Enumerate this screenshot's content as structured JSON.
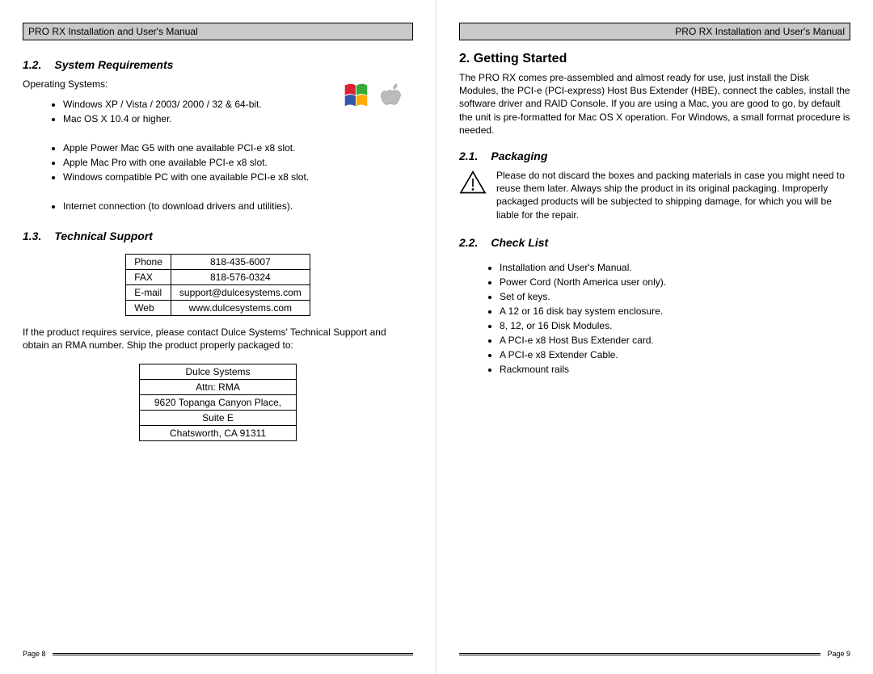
{
  "header": {
    "title": "PRO RX Installation and User's Manual"
  },
  "left": {
    "s12": {
      "num": "1.2.",
      "title": "System Requirements"
    },
    "os_label": "Operating Systems:",
    "os_list1": [
      "Windows XP / Vista / 2003/ 2000 /  32 & 64-bit.",
      "Mac OS X 10.4 or higher."
    ],
    "os_list2": [
      "Apple Power Mac G5 with one available PCI-e x8 slot.",
      "Apple Mac Pro with one available PCI-e x8 slot.",
      "Windows compatible PC with one available PCI-e x8 slot."
    ],
    "os_list3": [
      "Internet connection (to download drivers and utilities)."
    ],
    "s13": {
      "num": "1.3.",
      "title": "Technical Support"
    },
    "support": {
      "phone_l": "Phone",
      "phone_v": "818-435-6007",
      "fax_l": "FAX",
      "fax_v": "818-576-0324",
      "email_l": "E-mail",
      "email_v": "support@dulcesystems.com",
      "web_l": "Web",
      "web_v": "www.dulcesystems.com"
    },
    "rma_text": "If the product requires service, please contact Dulce Systems' Technical Support and obtain an RMA number.  Ship the product properly packaged to:",
    "address": {
      "l1": "Dulce Systems",
      "l2": "Attn: RMA",
      "l3": "9620 Topanga Canyon Place,",
      "l4": "Suite E",
      "l5": "Chatsworth, CA  91311"
    },
    "page_num": "Page 8"
  },
  "right": {
    "chapter": "2. Getting Started",
    "intro": "The PRO RX comes pre-assembled and almost ready for use, just install the Disk Modules, the PCI-e (PCI-express) Host Bus Extender (HBE), connect the cables, install the software driver and RAID Console.  If you are using a Mac, you are good to go, by default the unit is pre-formatted for Mac OS X operation.  For Windows, a small format procedure is needed.",
    "s21": {
      "num": "2.1.",
      "title": "Packaging"
    },
    "packaging_text": "Please do not discard the boxes and packing materials in case you might need to reuse them later.  Always ship the product in its original packaging.  Improperly packaged products will be subjected to shipping damage, for which you will be liable for the repair.",
    "s22": {
      "num": "2.2.",
      "title": "Check List"
    },
    "checklist": [
      "Installation and User's Manual.",
      "Power Cord (North America user only).",
      "Set of keys.",
      "A 12 or 16 disk bay system enclosure.",
      "8, 12, or 16 Disk Modules.",
      "A PCI-e x8 Host Bus Extender card.",
      "A PCI-e x8 Extender Cable.",
      "Rackmount rails"
    ],
    "page_num": "Page 9"
  }
}
